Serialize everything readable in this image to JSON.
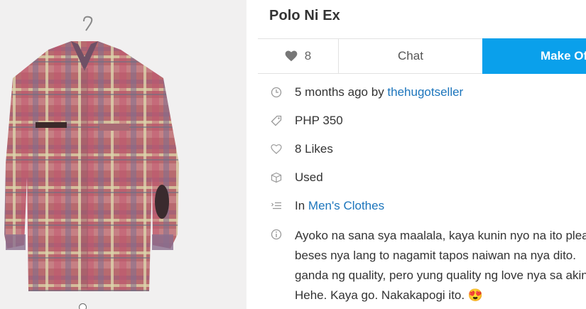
{
  "listing": {
    "title": "Polo Ni Ex",
    "likes_count": "8",
    "chat_label": "Chat",
    "offer_label": "Make Offer"
  },
  "meta": {
    "time_prefix": "5 months ago by ",
    "seller": "thehugotseller",
    "price": "PHP 350",
    "likes_text": "8 Likes",
    "condition": "Used",
    "category_prefix": "In ",
    "category": "Men's Clothes"
  },
  "description": {
    "lines": [
      "Ayoko na sana sya maalala, kaya kunin nyo na ito plea",
      "beses nya lang to nagamit tapos naiwan na nya dito.",
      "ganda ng quality, pero yung quality ng love nya sa akin",
      "Hehe. Kaya go. Nakakapogi ito. 😍"
    ]
  },
  "colors": {
    "accent": "#0aa0eb",
    "link": "#1c75bc"
  },
  "icons": {
    "likes": "heart-icon",
    "time": "clock-icon",
    "price": "tag-icon",
    "likes_meta": "heart-outline-icon",
    "condition": "box-icon",
    "category": "list-icon",
    "description": "info-icon"
  }
}
